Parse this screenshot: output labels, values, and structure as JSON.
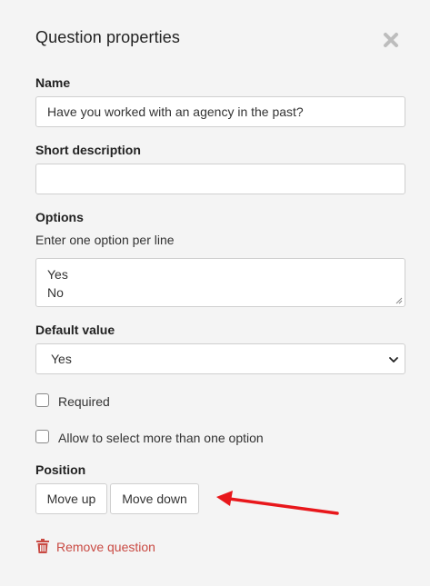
{
  "dialog": {
    "title": "Question properties",
    "close_icon": "close-icon"
  },
  "name_field": {
    "label": "Name",
    "value": "Have you worked with an agency in the past?"
  },
  "short_description_field": {
    "label": "Short description",
    "value": ""
  },
  "options_field": {
    "label": "Options",
    "hint": "Enter one option per line",
    "lines": [
      "Yes",
      "No"
    ]
  },
  "default_value_field": {
    "label": "Default value",
    "selected": "Yes"
  },
  "checkboxes": {
    "required_label": "Required",
    "required_checked": false,
    "multi_label": "Allow to select more than one option",
    "multi_checked": false
  },
  "position": {
    "label": "Position",
    "move_up_label": "Move up",
    "move_down_label": "Move down"
  },
  "remove": {
    "label": "Remove question",
    "icon": "trash-icon"
  },
  "colors": {
    "background": "#f4f4f4",
    "danger": "#c94a43",
    "annotation_arrow": "#e8171b"
  }
}
